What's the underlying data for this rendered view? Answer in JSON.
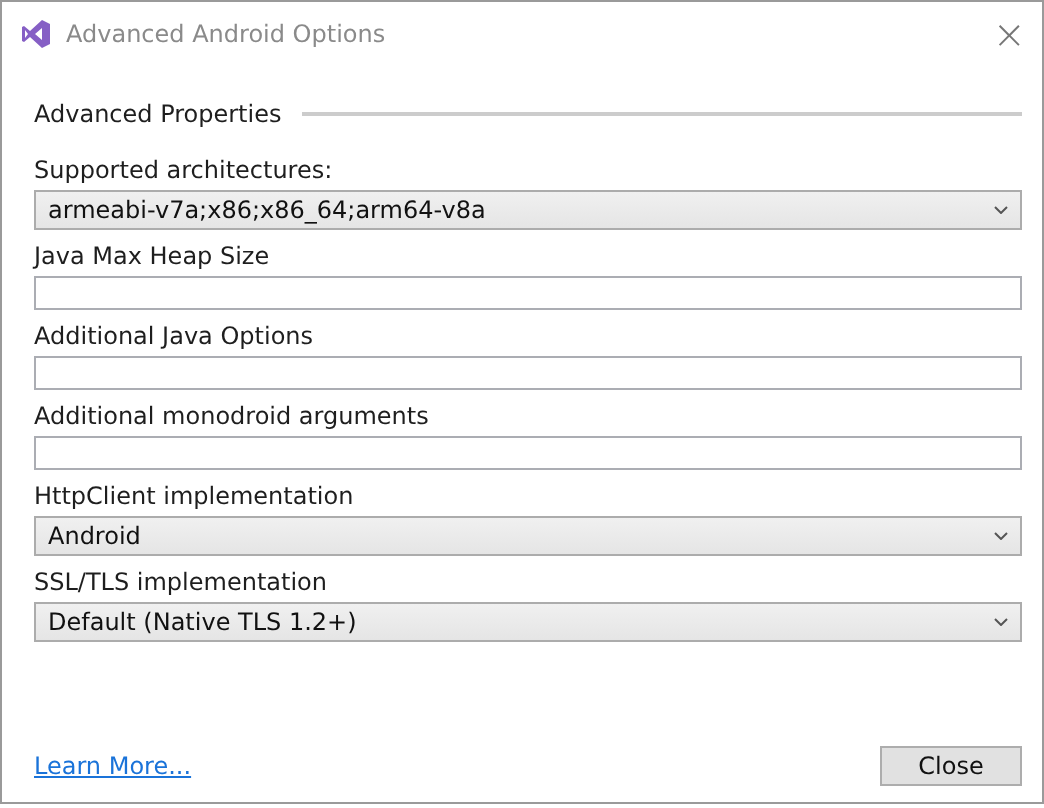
{
  "window": {
    "title": "Advanced Android Options",
    "close": "×"
  },
  "section": {
    "title": "Advanced Properties"
  },
  "fields": [
    {
      "kind": "select",
      "label": "Supported architectures:",
      "value": "armeabi-v7a;x86;x86_64;arm64-v8a"
    },
    {
      "kind": "text",
      "label": "Java Max Heap Size"
    },
    {
      "kind": "text",
      "label": "Additional Java Options"
    },
    {
      "kind": "text",
      "label": "Additional monodroid arguments"
    },
    {
      "kind": "select",
      "label": "HttpClient implementation",
      "value": "Android"
    },
    {
      "kind": "select",
      "label": "SSL/TLS implementation",
      "value": "Default (Native TLS 1.2+)"
    }
  ],
  "footer": {
    "link": "Learn More...",
    "button": "Close"
  }
}
